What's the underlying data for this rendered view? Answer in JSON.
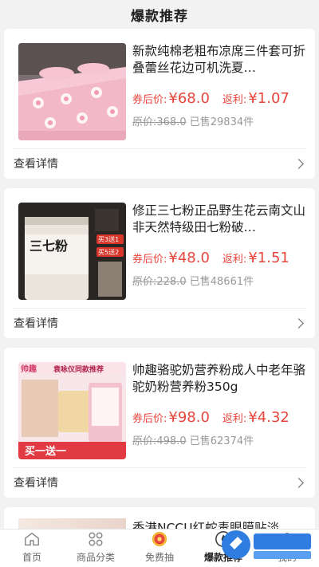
{
  "header": {
    "title": "爆款推荐"
  },
  "products": [
    {
      "title": "新款纯棉老粗布凉席三件套可折叠蕾丝花边可机洗夏…",
      "price_label": "券后价:",
      "price": "¥68.0",
      "rebate_label": "返利:",
      "rebate": "¥1.07",
      "orig_price": "原价:368.0",
      "sold": "已售29834件",
      "detail": "查看详情"
    },
    {
      "title": "修正三七粉正品野生花云南文山非天然特级田七粉破…",
      "price_label": "券后价:",
      "price": "¥48.0",
      "rebate_label": "返利:",
      "rebate": "¥1.51",
      "orig_price": "原价:228.0",
      "sold": "已售48661件",
      "detail": "查看详情"
    },
    {
      "title": "帅趣骆驼奶营养粉成人中老年骆驼奶粉营养粉350g",
      "price_label": "券后价:",
      "price": "¥98.0",
      "rebate_label": "返利:",
      "rebate": "¥4.32",
      "orig_price": "原价:498.0",
      "sold": "已售62374件",
      "detail": "查看详情"
    }
  ],
  "partial_item": {
    "title": "香港NCCU红蛇毒眼膜贴淡"
  },
  "product_images": {
    "p2_label": "三七粉",
    "p2_badge1": "买3送1",
    "p2_badge2": "买5送2",
    "p3_brand": "帅趣",
    "p3_banner": "袁咏仪同款推荐",
    "p3_promo": "买一送一"
  },
  "tabbar": [
    {
      "label": "首页",
      "icon": "home-icon"
    },
    {
      "label": "商品分类",
      "icon": "category-icon"
    },
    {
      "label": "免费抽",
      "icon": "gift-icon"
    },
    {
      "label": "爆款推荐",
      "icon": "fire-icon"
    },
    {
      "label": "我的",
      "icon": "user-icon"
    }
  ],
  "colors": {
    "accent": "#e8453c",
    "muted": "#999999"
  }
}
